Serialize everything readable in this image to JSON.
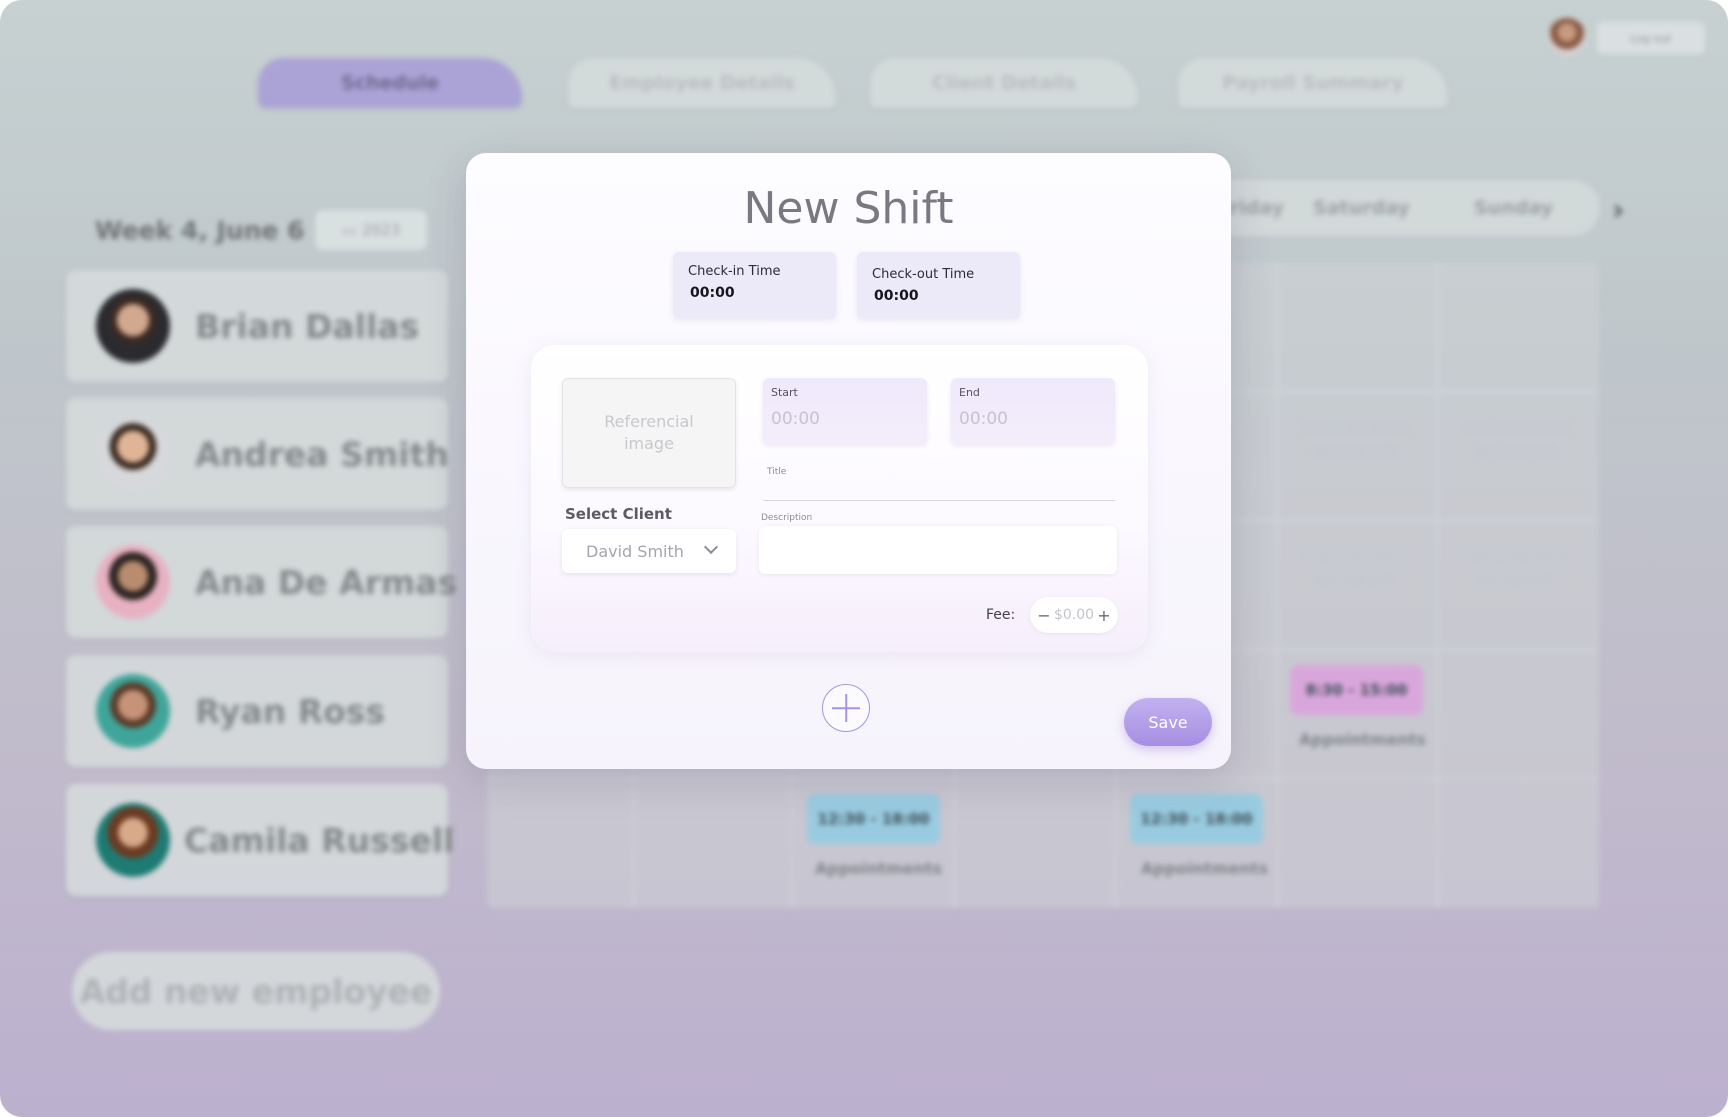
{
  "nav": {
    "tabs": [
      "Schedule",
      "Employee Details",
      "Client Details",
      "Payroll Summary"
    ],
    "active_tab": "Schedule",
    "logout_label": "Log out"
  },
  "schedule": {
    "week_label": "Week 4, June 6",
    "year": "2023",
    "employees": [
      "Brian Dallas",
      "Andrea Smith",
      "Ana De Armas",
      "Ryan Ross",
      "Camila Russell"
    ],
    "add_employee_label": "Add new employee",
    "days": [
      "Friday",
      "Saturday",
      "Sunday"
    ],
    "cell_hint": "Click in the box to add new shift",
    "shifts": [
      {
        "time": "8:30 - 15:00",
        "label": "Appointments",
        "color": "#d9a6dc"
      },
      {
        "time": "12:30 - 18:00",
        "label": "Appointments",
        "color": "#99cbe0"
      },
      {
        "time": "12:30 - 18:00",
        "label": "Appointments",
        "color": "#99cbe0"
      }
    ],
    "partial_shift_label": "nts"
  },
  "modal": {
    "title": "New Shift",
    "check_in": {
      "label": "Check-in Time",
      "value": "00:00"
    },
    "check_out": {
      "label": "Check-out Time",
      "value": "00:00"
    },
    "reference_image_label": "Referencial image",
    "start": {
      "label": "Start",
      "value": "00:00"
    },
    "end": {
      "label": "End",
      "value": "00:00"
    },
    "title_field_label": "Title",
    "select_client_label": "Select Client",
    "selected_client": "David Smith",
    "description_label": "Description",
    "fee_label": "Fee:",
    "fee_value": "$0.00",
    "fee_minus": "−",
    "fee_plus": "+",
    "save_label": "Save"
  },
  "colors": {
    "accent": "#a68ee3",
    "active_tab": "#aba2d6",
    "green_shift": "#8fd8a8"
  }
}
